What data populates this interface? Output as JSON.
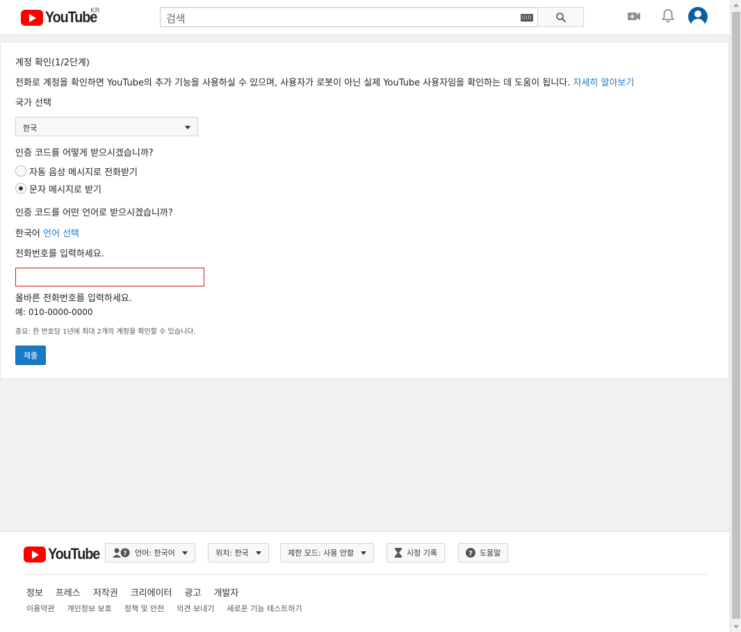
{
  "header": {
    "logo_text": "YouTube",
    "region": "KR",
    "search_placeholder": "검색"
  },
  "page": {
    "title": "계정 확인(1/2단계)",
    "description": "전화로 계정을 확인하면 YouTube의 추가 기능을 사용하실 수 있으며, 사용자가 로봇이 아닌 실제 YouTube 사용자임을 확인하는 데 도움이 됩니다.",
    "learn_more": "자세히 알아보기",
    "country_label": "국가 선택",
    "country_value": "한국",
    "method_question": "인증 코드를 어떻게 받으시겠습니까?",
    "method_options": [
      "자동 음성 메시지로 전화받기",
      "문자 메시지로 받기"
    ],
    "method_selected": 1,
    "language_question": "인증 코드를 어떤 언어로 받으시겠습니까?",
    "language_value": "한국어",
    "language_link": "언어 선택",
    "phone_label": "전화번호를 입력하세요.",
    "phone_value": "",
    "phone_error": "올바른 전화번호를 입력하세요.",
    "phone_example": "예: 010-0000-0000",
    "note": "중요: 한 번호당 1년에 최대 2개의 계정을 확인할 수 있습니다.",
    "submit": "제출"
  },
  "footer": {
    "logo_text": "YouTube",
    "language_button": "언어: 한국어",
    "location_button": "위치: 한국",
    "restricted_button": "제한 모드: 사용 안함",
    "history_button": "시청 기록",
    "help_button": "도움말",
    "links_primary": [
      "정보",
      "프레스",
      "저작권",
      "크리에이터",
      "광고",
      "개발자"
    ],
    "links_secondary": [
      "이용약관",
      "개인정보 보호",
      "정책 및 안전",
      "의견 보내기",
      "새로운 기능 테스트하기"
    ]
  },
  "colors": {
    "brand": "#ff0000",
    "link": "#167ac6",
    "error": "#c8171e",
    "submit": "#167ac6"
  }
}
